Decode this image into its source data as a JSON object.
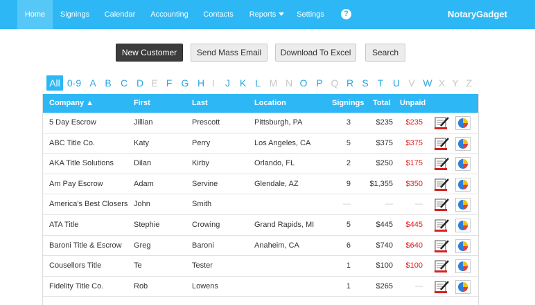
{
  "nav": {
    "items": [
      "Home",
      "Signings",
      "Calendar",
      "Accounting",
      "Contacts",
      "Reports",
      "Settings"
    ],
    "help": "?",
    "brand": "NotaryGadget"
  },
  "actions": {
    "new_customer": "New Customer",
    "send_mass_email": "Send Mass Email",
    "download_excel": "Download To Excel",
    "search": "Search"
  },
  "alphabet": [
    {
      "label": "All",
      "state": "active"
    },
    {
      "label": "0-9",
      "state": "on"
    },
    {
      "label": "A",
      "state": "on"
    },
    {
      "label": "B",
      "state": "on"
    },
    {
      "label": "C",
      "state": "on"
    },
    {
      "label": "D",
      "state": "on"
    },
    {
      "label": "E",
      "state": "off"
    },
    {
      "label": "F",
      "state": "on"
    },
    {
      "label": "G",
      "state": "on"
    },
    {
      "label": "H",
      "state": "on"
    },
    {
      "label": "I",
      "state": "off"
    },
    {
      "label": "J",
      "state": "on"
    },
    {
      "label": "K",
      "state": "on"
    },
    {
      "label": "L",
      "state": "on"
    },
    {
      "label": "M",
      "state": "off"
    },
    {
      "label": "N",
      "state": "off"
    },
    {
      "label": "O",
      "state": "on"
    },
    {
      "label": "P",
      "state": "on"
    },
    {
      "label": "Q",
      "state": "off"
    },
    {
      "label": "R",
      "state": "on"
    },
    {
      "label": "S",
      "state": "on"
    },
    {
      "label": "T",
      "state": "on"
    },
    {
      "label": "U",
      "state": "on"
    },
    {
      "label": "V",
      "state": "off"
    },
    {
      "label": "W",
      "state": "on"
    },
    {
      "label": "X",
      "state": "off"
    },
    {
      "label": "Y",
      "state": "off"
    },
    {
      "label": "Z",
      "state": "off"
    }
  ],
  "table": {
    "headers": {
      "company": "Company ▲",
      "first": "First",
      "last": "Last",
      "location": "Location",
      "signings": "Signings",
      "total": "Total",
      "unpaid": "Unpaid"
    },
    "rows": [
      {
        "company": "5 Day Escrow",
        "first": "Jillian",
        "last": "Prescott",
        "location": "Pittsburgh, PA",
        "signings": "3",
        "total": "$235",
        "unpaid": "$235"
      },
      {
        "company": "ABC Title Co.",
        "first": "Katy",
        "last": "Perry",
        "location": "Los Angeles, CA",
        "signings": "5",
        "total": "$375",
        "unpaid": "$375"
      },
      {
        "company": "AKA Title Solutions",
        "first": "Dilan",
        "last": "Kirby",
        "location": "Orlando, FL",
        "signings": "2",
        "total": "$250",
        "unpaid": "$175"
      },
      {
        "company": "Am Pay Escrow",
        "first": "Adam",
        "last": "Servine",
        "location": "Glendale, AZ",
        "signings": "9",
        "total": "$1,355",
        "unpaid": "$350"
      },
      {
        "company": "America's Best Closers",
        "first": "John",
        "last": "Smith",
        "location": "",
        "signings": "—",
        "total": "—",
        "unpaid": "—"
      },
      {
        "company": "ATA Title",
        "first": "Stephie",
        "last": "Crowing",
        "location": "Grand Rapids, MI",
        "signings": "5",
        "total": "$445",
        "unpaid": "$445"
      },
      {
        "company": "Baroni Title & Escrow",
        "first": "Greg",
        "last": "Baroni",
        "location": "Anaheim, CA",
        "signings": "6",
        "total": "$740",
        "unpaid": "$640"
      },
      {
        "company": "Cousellors Title",
        "first": "Te",
        "last": "Tester",
        "location": "",
        "signings": "1",
        "total": "$100",
        "unpaid": "$100"
      },
      {
        "company": "Fidelity Title Co.",
        "first": "Rob",
        "last": "Lowens",
        "location": "",
        "signings": "1",
        "total": "$265",
        "unpaid": "—"
      }
    ]
  },
  "icons": {
    "sign": "sign-document-icon",
    "pie": "pie-chart-icon"
  },
  "colors": {
    "nav": "#2db8f5",
    "link": "#2aa8e0",
    "unpaid": "#e02020",
    "disabled": "#c6c6c6"
  }
}
